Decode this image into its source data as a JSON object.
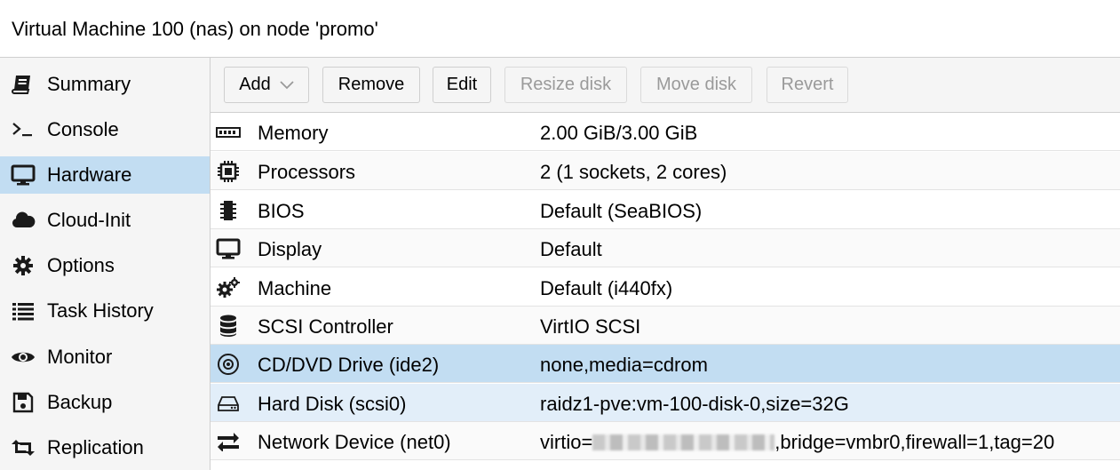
{
  "window": {
    "title": "Virtual Machine 100 (nas) on node 'promo'"
  },
  "sidebar": {
    "items": [
      {
        "label": "Summary",
        "icon": "book-icon"
      },
      {
        "label": "Console",
        "icon": "terminal-icon"
      },
      {
        "label": "Hardware",
        "icon": "desktop-icon",
        "active": true
      },
      {
        "label": "Cloud-Init",
        "icon": "cloud-icon"
      },
      {
        "label": "Options",
        "icon": "gear-icon"
      },
      {
        "label": "Task History",
        "icon": "list-icon"
      },
      {
        "label": "Monitor",
        "icon": "eye-icon"
      },
      {
        "label": "Backup",
        "icon": "floppy-icon"
      },
      {
        "label": "Replication",
        "icon": "retweet-icon"
      }
    ]
  },
  "toolbar": {
    "add_label": "Add",
    "remove_label": "Remove",
    "edit_label": "Edit",
    "resize_label": "Resize disk",
    "move_label": "Move disk",
    "revert_label": "Revert"
  },
  "hardware": {
    "rows": [
      {
        "name": "Memory",
        "value": "2.00 GiB/3.00 GiB",
        "icon": "memory-icon"
      },
      {
        "name": "Processors",
        "value": "2 (1 sockets, 2 cores)",
        "icon": "cpu-icon"
      },
      {
        "name": "BIOS",
        "value": "Default (SeaBIOS)",
        "icon": "chip-icon"
      },
      {
        "name": "Display",
        "value": "Default",
        "icon": "desktop-icon"
      },
      {
        "name": "Machine",
        "value": "Default (i440fx)",
        "icon": "cogs-icon"
      },
      {
        "name": "SCSI Controller",
        "value": "VirtIO SCSI",
        "icon": "database-icon"
      },
      {
        "name": "CD/DVD Drive (ide2)",
        "value": "none,media=cdrom",
        "icon": "disc-icon"
      },
      {
        "name": "Hard Disk (scsi0)",
        "value": "raidz1-pve:vm-100-disk-0,size=32G",
        "icon": "hdd-icon"
      },
      {
        "name": "Network Device (net0)",
        "value_prefix": "virtio=",
        "value_suffix": ",bridge=vmbr0,firewall=1,tag=20",
        "icon": "exchange-icon"
      }
    ]
  },
  "colors": {
    "selected": "#c2ddf2",
    "hover": "#e2eef9",
    "sidebar_bg": "#f5f5f5"
  }
}
